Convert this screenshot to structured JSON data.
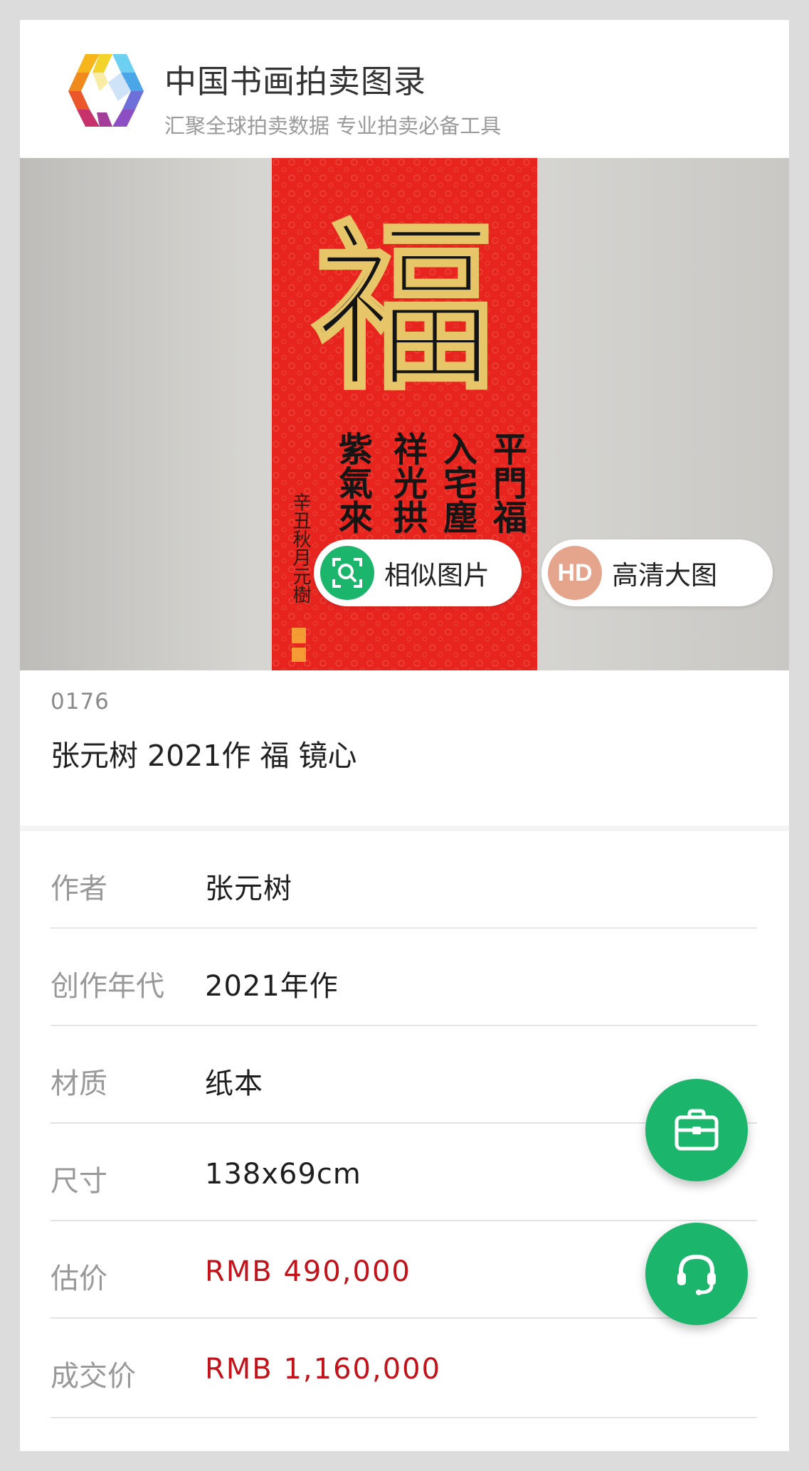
{
  "header": {
    "title": "中国书画拍卖图录",
    "subtitle": "汇聚全球拍卖数据 专业拍卖必备工具"
  },
  "hero": {
    "similar_button_label": "相似图片",
    "hd_button_label": "高清大图",
    "hd_badge": "HD",
    "artwork": {
      "main_char": "福",
      "col1": "平門福",
      "col2": "入宅塵",
      "col3": "祥光拱",
      "col4": "紫氣來",
      "inscription": "辛丑秋月元樹"
    }
  },
  "lot": {
    "number": "0176",
    "title": "张元树 2021作 福 镜心"
  },
  "details": [
    {
      "key": "作者",
      "value": "张元树"
    },
    {
      "key": "创作年代",
      "value": "2021年作"
    },
    {
      "key": "材质",
      "value": "纸本"
    },
    {
      "key": "尺寸",
      "value": "138x69cm"
    },
    {
      "key": "估价",
      "value": "RMB 490,000"
    },
    {
      "key": "成交价",
      "value": "RMB 1,160,000"
    }
  ],
  "colors": {
    "accent_green": "#1bb56b",
    "price_red": "#c2121a",
    "hd_badge": "#e4a58c"
  },
  "icons": {
    "tools": "briefcase-icon",
    "support": "headset-icon",
    "similar": "image-search-icon"
  }
}
